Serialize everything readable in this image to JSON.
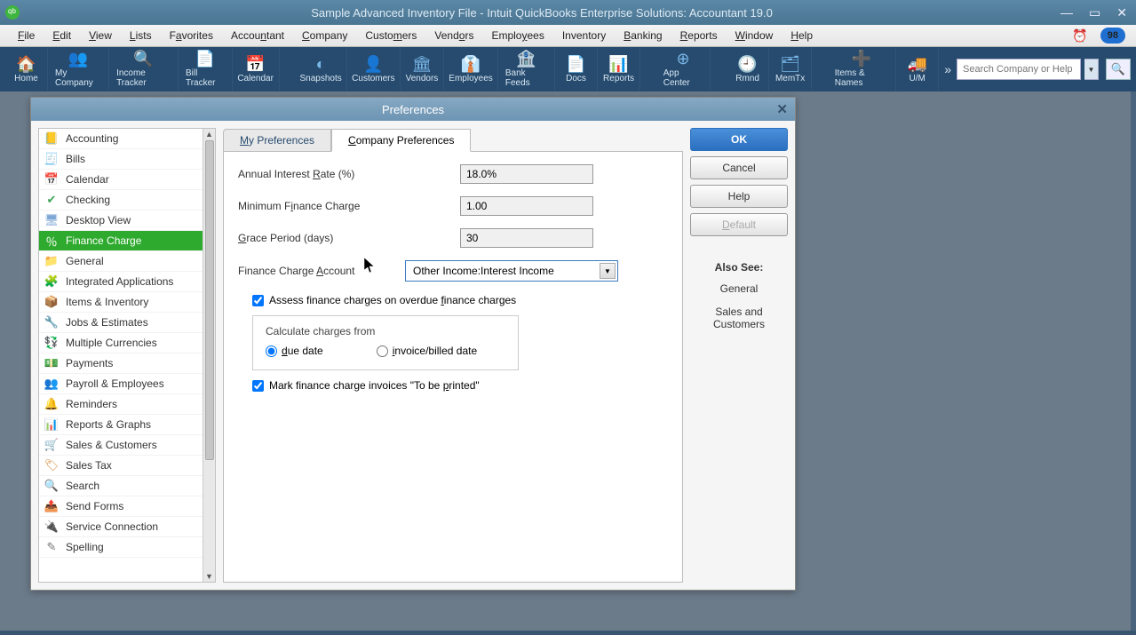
{
  "titlebar": {
    "title": "Sample Advanced Inventory File  -  Intuit QuickBooks Enterprise Solutions: Accountant 19.0"
  },
  "menubar": {
    "items": [
      "File",
      "Edit",
      "View",
      "Lists",
      "Favorites",
      "Accountant",
      "Company",
      "Customers",
      "Vendors",
      "Employees",
      "Inventory",
      "Banking",
      "Reports",
      "Window",
      "Help"
    ],
    "badge": "98"
  },
  "toolbar": {
    "items": [
      {
        "label": "Home",
        "icon": "🏠"
      },
      {
        "label": "My Company",
        "icon": "👥"
      },
      {
        "label": "Income Tracker",
        "icon": "🔍"
      },
      {
        "label": "Bill Tracker",
        "icon": "📄"
      },
      {
        "label": "Calendar",
        "icon": "📅"
      },
      {
        "label": "Snapshots",
        "icon": "◐"
      },
      {
        "label": "Customers",
        "icon": "👤"
      },
      {
        "label": "Vendors",
        "icon": "🏛"
      },
      {
        "label": "Employees",
        "icon": "👔"
      },
      {
        "label": "Bank Feeds",
        "icon": "🏦"
      },
      {
        "label": "Docs",
        "icon": "📄"
      },
      {
        "label": "Reports",
        "icon": "📊"
      },
      {
        "label": "App Center",
        "icon": "⊕"
      },
      {
        "label": "Rmnd",
        "icon": "🕘"
      },
      {
        "label": "MemTx",
        "icon": "🗂"
      },
      {
        "label": "Items & Names",
        "icon": "➕"
      },
      {
        "label": "U/M",
        "icon": "🚚"
      }
    ],
    "search_placeholder": "Search Company or Help"
  },
  "dialog": {
    "title": "Preferences",
    "categories": [
      {
        "label": "Accounting",
        "icon": "📒",
        "color": "#d9a441"
      },
      {
        "label": "Bills",
        "icon": "🧾",
        "color": "#5d8fc9"
      },
      {
        "label": "Calendar",
        "icon": "📅",
        "color": "#5d8fc9"
      },
      {
        "label": "Checking",
        "icon": "✔",
        "color": "#3da558"
      },
      {
        "label": "Desktop View",
        "icon": "🖥",
        "color": "#7fa8d6"
      },
      {
        "label": "Finance Charge",
        "icon": "％",
        "color": "#8b5fc2",
        "active": true
      },
      {
        "label": "General",
        "icon": "📁",
        "color": "#d9a441"
      },
      {
        "label": "Integrated Applications",
        "icon": "🧩",
        "color": "#7a7a7a"
      },
      {
        "label": "Items & Inventory",
        "icon": "📦",
        "color": "#d9a441"
      },
      {
        "label": "Jobs & Estimates",
        "icon": "🔧",
        "color": "#d48a3a"
      },
      {
        "label": "Multiple Currencies",
        "icon": "💱",
        "color": "#3da558"
      },
      {
        "label": "Payments",
        "icon": "💵",
        "color": "#3da558"
      },
      {
        "label": "Payroll & Employees",
        "icon": "👥",
        "color": "#5d8fc9"
      },
      {
        "label": "Reminders",
        "icon": "🔔",
        "color": "#d9a441"
      },
      {
        "label": "Reports & Graphs",
        "icon": "📊",
        "color": "#3a8"
      },
      {
        "label": "Sales & Customers",
        "icon": "🛒",
        "color": "#d48a3a"
      },
      {
        "label": "Sales Tax",
        "icon": "🏷",
        "color": "#d48a3a"
      },
      {
        "label": "Search",
        "icon": "🔍",
        "color": "#7a7a7a"
      },
      {
        "label": "Send Forms",
        "icon": "📤",
        "color": "#5d8fc9"
      },
      {
        "label": "Service Connection",
        "icon": "🔌",
        "color": "#5d8fc9"
      },
      {
        "label": "Spelling",
        "icon": "✎",
        "color": "#7a7a7a"
      }
    ],
    "tabs": {
      "my_pref": "My Preferences",
      "company_pref": "Company Preferences"
    },
    "form": {
      "annual_rate_label": "Annual Interest Rate (%)",
      "annual_rate_value": "18.0%",
      "min_charge_label": "Minimum Finance Charge",
      "min_charge_value": "1.00",
      "grace_label": "Grace Period (days)",
      "grace_value": "30",
      "account_label": "Finance Charge Account",
      "account_value": "Other Income:Interest Income",
      "assess_label": "Assess finance charges on overdue finance charges",
      "calc_legend": "Calculate charges from",
      "radio_due": "due date",
      "radio_invoice": "invoice/billed date",
      "mark_print_label": "Mark finance charge invoices \"To be printed\""
    },
    "buttons": {
      "ok": "OK",
      "cancel": "Cancel",
      "help": "Help",
      "default": "Default"
    },
    "also_see": {
      "header": "Also See:",
      "links": [
        "General",
        "Sales and Customers"
      ]
    }
  }
}
